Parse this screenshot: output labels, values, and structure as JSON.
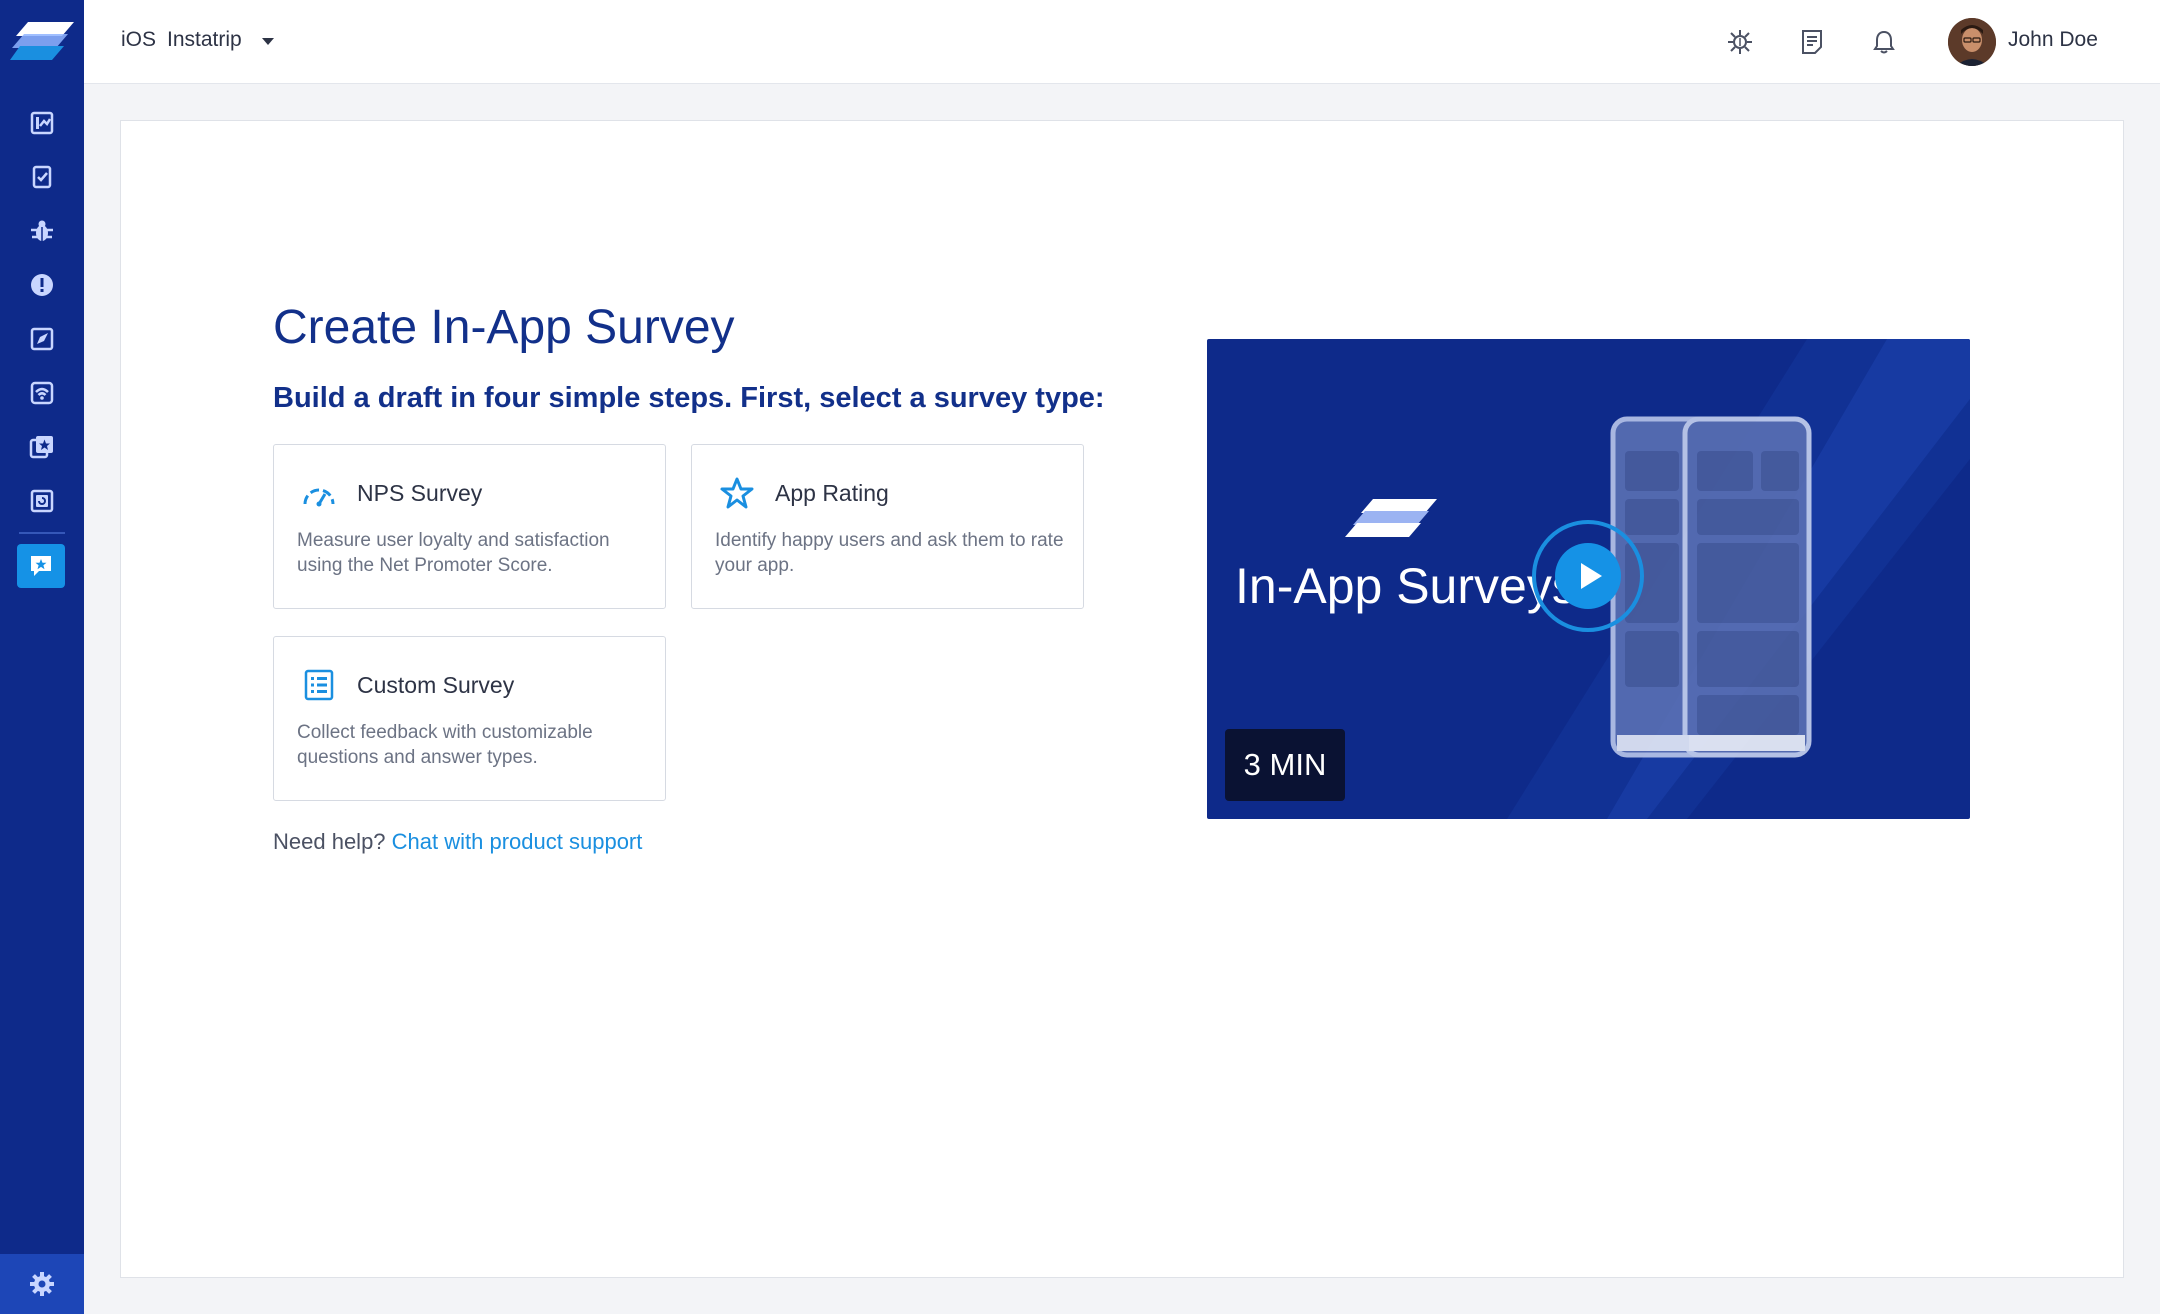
{
  "header": {
    "platform": "iOS",
    "app_name": "Instatrip",
    "user_name": "John Doe",
    "icons": [
      "debug-icon",
      "docs-icon",
      "bell-icon"
    ]
  },
  "sidebar": {
    "items": [
      {
        "icon": "dashboard-icon"
      },
      {
        "icon": "checklist-icon"
      },
      {
        "icon": "bug-icon"
      },
      {
        "icon": "alert-icon"
      },
      {
        "icon": "features-icon"
      },
      {
        "icon": "network-icon"
      },
      {
        "icon": "starred-icon"
      },
      {
        "icon": "replay-icon"
      },
      {
        "icon": "surveys-icon",
        "active": true
      }
    ],
    "bottom_icon": "gear-icon"
  },
  "main": {
    "title": "Create In-App Survey",
    "subtitle": "Build a draft in four simple steps. First, select a survey type:",
    "cards": [
      {
        "title": "NPS Survey",
        "description": "Measure user loyalty and satisfaction using the Net Promoter Score.",
        "icon": "gauge-icon"
      },
      {
        "title": "App Rating",
        "description": "Identify happy users and ask them to rate your app.",
        "icon": "star-icon"
      },
      {
        "title": "Custom Survey",
        "description": "Collect feedback with customizable questions and answer types.",
        "icon": "list-icon"
      }
    ],
    "help_text": "Need help?",
    "help_link": "Chat with product support"
  },
  "video": {
    "title": "In-App Surveys",
    "duration": "3 MIN"
  },
  "colors": {
    "sidebar": "#0e2a8a",
    "accent": "#1592e6",
    "title": "#12308a",
    "link": "#1a8fe0"
  }
}
